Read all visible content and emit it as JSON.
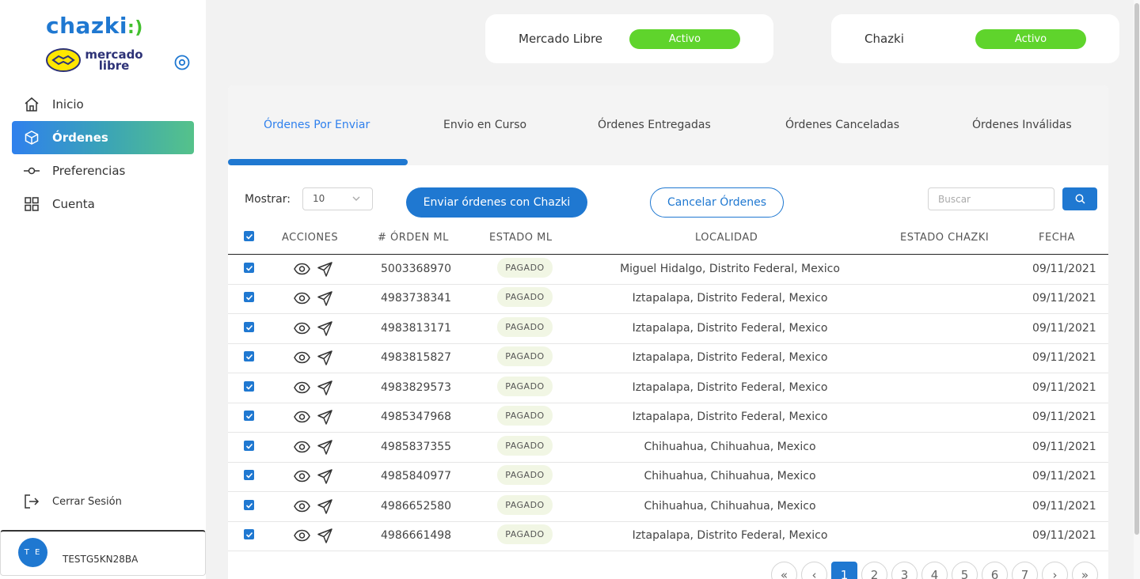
{
  "brand": {
    "chazki": "chazki",
    "mercado_libre": "mercado libre"
  },
  "sidebar": {
    "items": [
      {
        "label": "Inicio",
        "icon": "home-icon"
      },
      {
        "label": "Órdenes",
        "icon": "box-icon",
        "active": true
      },
      {
        "label": "Preferencias",
        "icon": "preferences-icon"
      },
      {
        "label": "Cuenta",
        "icon": "grid-icon"
      }
    ],
    "logout_label": "Cerrar Sesión",
    "user": {
      "initials": "T E",
      "name": "TESTG5KN28BA"
    }
  },
  "status": [
    {
      "name": "Mercado Libre",
      "state": "Activo"
    },
    {
      "name": "Chazki",
      "state": "Activo"
    }
  ],
  "tabs": [
    {
      "label": "Órdenes Por Enviar",
      "active": true
    },
    {
      "label": "Envio en Curso"
    },
    {
      "label": "Órdenes Entregadas"
    },
    {
      "label": "Órdenes Canceladas"
    },
    {
      "label": "Órdenes Inválidas"
    }
  ],
  "toolbar": {
    "show_label": "Mostrar:",
    "page_size": "10",
    "send_label": "Enviar órdenes con Chazki",
    "cancel_label": "Cancelar Órdenes",
    "search_placeholder": "Buscar"
  },
  "table": {
    "headers": [
      "ACCIONES",
      "# ÓRDEN ML",
      "ESTADO ML",
      "LOCALIDAD",
      "ESTADO CHAZKI",
      "FECHA"
    ],
    "rows": [
      {
        "order": "5003368970",
        "status": "PAGADO",
        "location": "Miguel Hidalgo, Distrito Federal, Mexico",
        "chazki": "",
        "date": "09/11/2021"
      },
      {
        "order": "4983738341",
        "status": "PAGADO",
        "location": "Iztapalapa, Distrito Federal, Mexico",
        "chazki": "",
        "date": "09/11/2021"
      },
      {
        "order": "4983813171",
        "status": "PAGADO",
        "location": "Iztapalapa, Distrito Federal, Mexico",
        "chazki": "",
        "date": "09/11/2021"
      },
      {
        "order": "4983815827",
        "status": "PAGADO",
        "location": "Iztapalapa, Distrito Federal, Mexico",
        "chazki": "",
        "date": "09/11/2021"
      },
      {
        "order": "4983829573",
        "status": "PAGADO",
        "location": "Iztapalapa, Distrito Federal, Mexico",
        "chazki": "",
        "date": "09/11/2021"
      },
      {
        "order": "4985347968",
        "status": "PAGADO",
        "location": "Iztapalapa, Distrito Federal, Mexico",
        "chazki": "",
        "date": "09/11/2021"
      },
      {
        "order": "4985837355",
        "status": "PAGADO",
        "location": "Chihuahua, Chihuahua, Mexico",
        "chazki": "",
        "date": "09/11/2021"
      },
      {
        "order": "4985840977",
        "status": "PAGADO",
        "location": "Chihuahua, Chihuahua, Mexico",
        "chazki": "",
        "date": "09/11/2021"
      },
      {
        "order": "4986652580",
        "status": "PAGADO",
        "location": "Chihuahua, Chihuahua, Mexico",
        "chazki": "",
        "date": "09/11/2021"
      },
      {
        "order": "4986661498",
        "status": "PAGADO",
        "location": "Iztapalapa, Distrito Federal, Mexico",
        "chazki": "",
        "date": "09/11/2021"
      }
    ]
  },
  "pagination": {
    "first": "«",
    "prev": "‹",
    "pages": [
      "1",
      "2",
      "3",
      "4",
      "5",
      "6",
      "7"
    ],
    "current": "1",
    "next": "›",
    "last": "»"
  },
  "colors": {
    "primary": "#1f78d1",
    "active_badge": "#5fd42c",
    "nav_gradient_end": "#55c28a"
  }
}
